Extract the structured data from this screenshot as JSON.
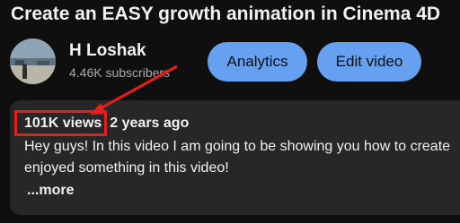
{
  "video": {
    "title": "Create an EASY growth animation in Cinema 4D"
  },
  "channel": {
    "name": "H Loshak",
    "subscribers": "4.46K subscribers",
    "avatar_icon": "channel-avatar-landscape"
  },
  "actions": {
    "analytics_label": "Analytics",
    "edit_label": "Edit video",
    "button_color": "#65a1f0"
  },
  "description": {
    "views": "101K views",
    "age": "2 years ago",
    "lines": [
      "Hey guys! In this video I am going to be showing you how to create",
      "enjoyed something in this video!"
    ],
    "more_label": "...more"
  },
  "annotation": {
    "color": "#e61e1e",
    "arrow_icon": "red-arrow"
  }
}
